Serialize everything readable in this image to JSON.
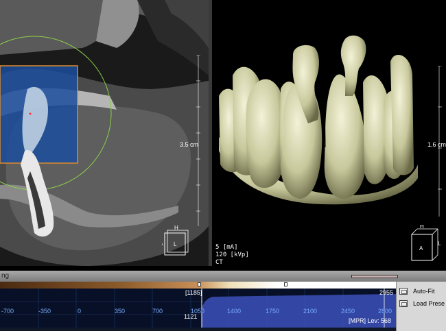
{
  "left_view": {
    "scale_label": "3.5 cm",
    "orientation": {
      "top": "H",
      "left": "A",
      "center": "L"
    }
  },
  "right_view": {
    "scale_label": "1.6 cm",
    "orientation": {
      "top": "H",
      "center": "A",
      "right": "L"
    },
    "info": {
      "ma": "5 [mA]",
      "kvp": "120 [kVp]",
      "modality": "CT"
    }
  },
  "bottom_panel": {
    "tab_label": "ng",
    "histogram": {
      "ticks": [
        "-700",
        "-350",
        "0",
        "350",
        "700",
        "1050",
        "1400",
        "1750",
        "2100",
        "2450",
        "2800"
      ],
      "window_top": "[1185]",
      "max_value": "2955",
      "window_low": "1121",
      "level_label": "[MPR] Lev:",
      "level_value": "568"
    },
    "buttons": {
      "auto_fit": "Auto-Fit",
      "load_preset": "Load Prese"
    }
  }
}
